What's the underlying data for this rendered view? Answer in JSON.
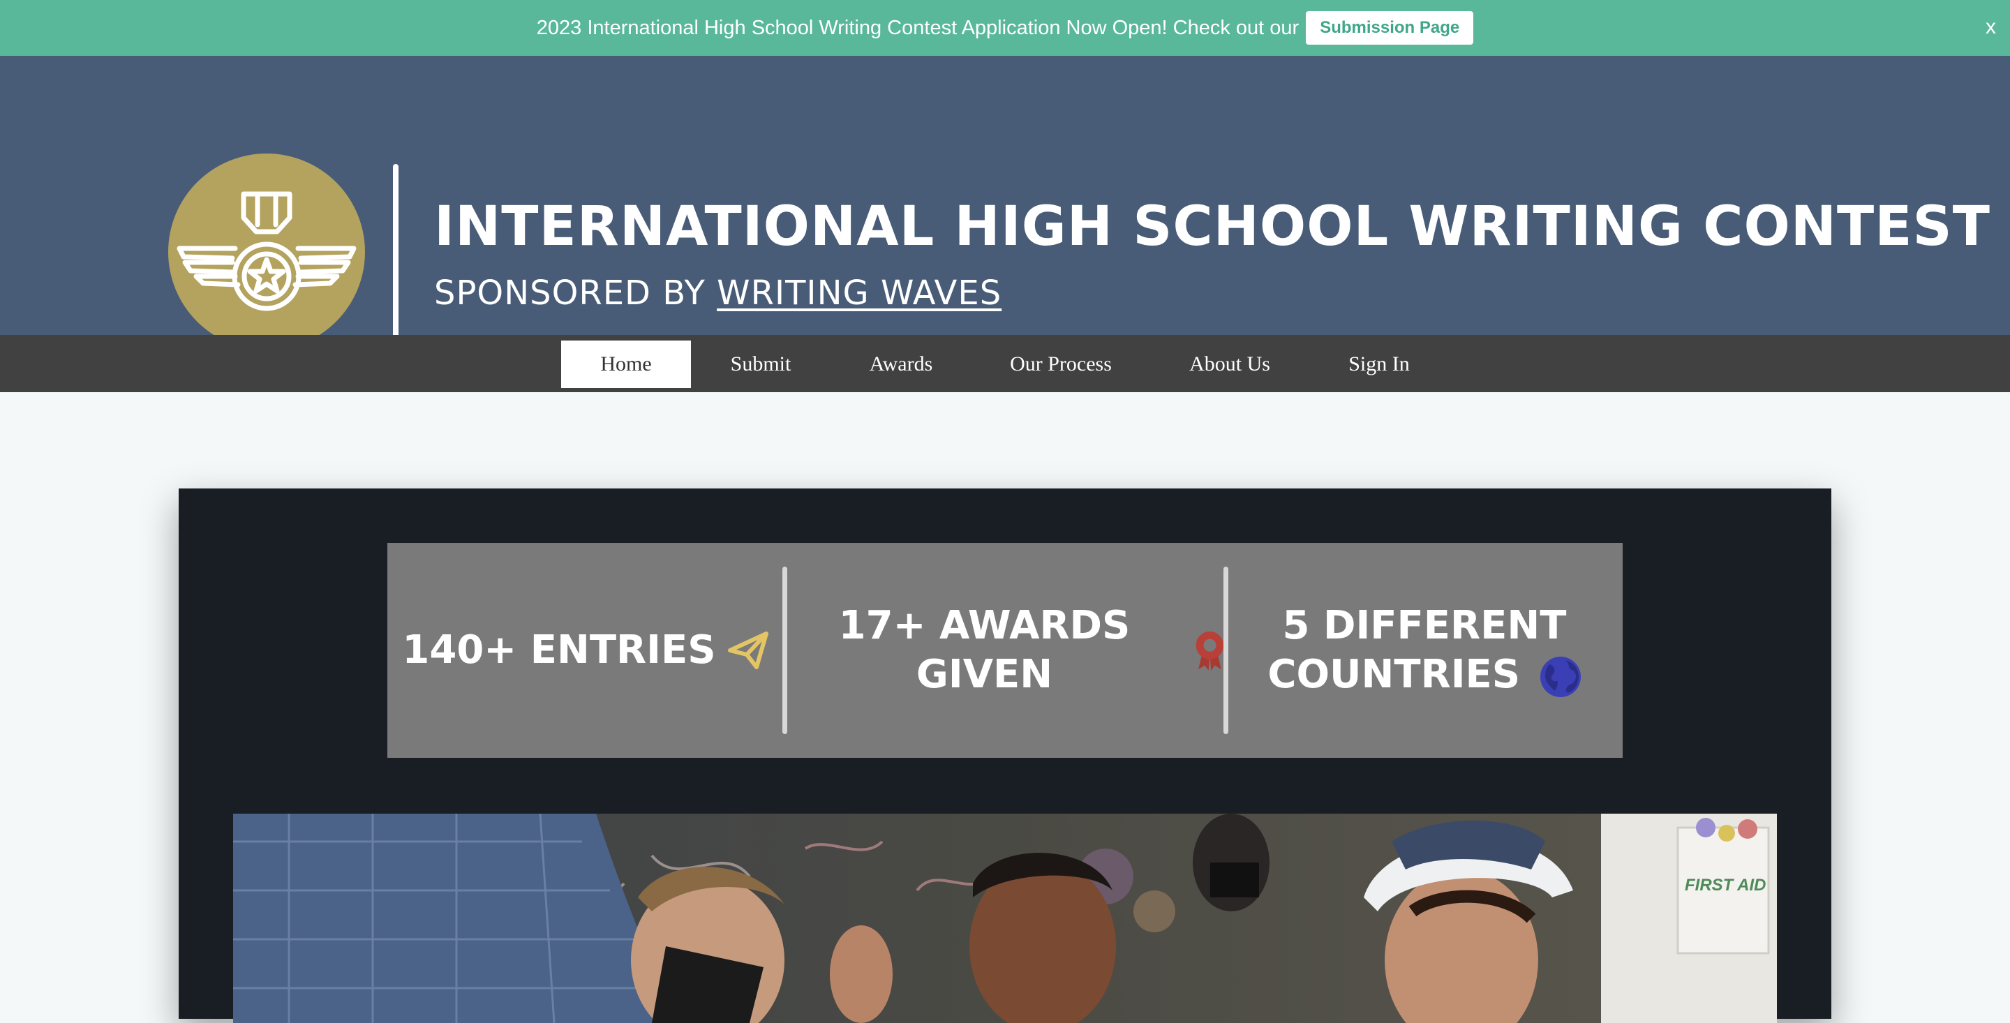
{
  "announcement": {
    "text": "2023 International High School Writing Contest Application Now Open! Check out our",
    "button_label": "Submission Page",
    "close_label": "x"
  },
  "header": {
    "title": "INTERNATIONAL HIGH SCHOOL WRITING CONTEST",
    "subtitle_prefix": "SPONSORED BY",
    "subtitle_link": "WRITING WAVES",
    "logo_icon": "medal-wings-icon"
  },
  "nav": {
    "items": [
      {
        "label": "Home",
        "active": true
      },
      {
        "label": "Submit",
        "active": false
      },
      {
        "label": "Awards",
        "active": false
      },
      {
        "label": "Our Process",
        "active": false
      },
      {
        "label": "About Us",
        "active": false
      },
      {
        "label": "Sign In",
        "active": false
      }
    ]
  },
  "stats": {
    "items": [
      {
        "label": "140+ ENTRIES",
        "icon": "paper-plane-icon"
      },
      {
        "label": "17+ AWARDS GIVEN",
        "icon": "award-ribbon-icon"
      },
      {
        "label_line1": "5 DIFFERENT",
        "label_line2": "COUNTRIES",
        "icon": "globe-icon"
      }
    ]
  },
  "photo": {
    "overlay_text": "FIRST AID"
  },
  "colors": {
    "announce_bg": "#59b89a",
    "header_bg": "#485c78",
    "nav_bg": "#414141",
    "logo_gold": "#b3a35e",
    "card_bg": "#191d24",
    "stats_bg": "#7a7a7a"
  }
}
